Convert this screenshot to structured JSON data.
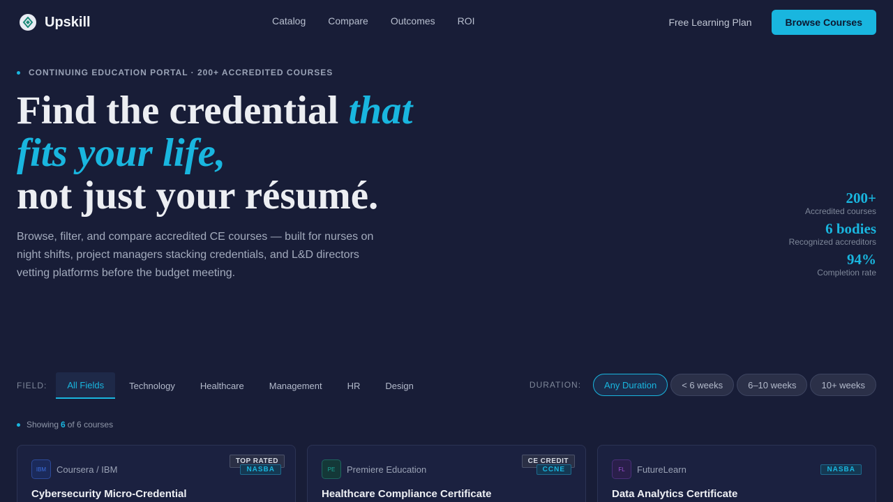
{
  "brand": {
    "name": "Upskill"
  },
  "nav": {
    "links": [
      "Catalog",
      "Compare",
      "Outcomes",
      "ROI"
    ],
    "free_plan": "Free Learning Plan",
    "cta": "Browse Courses"
  },
  "hero": {
    "eyebrow": "CONTINUING EDUCATION PORTAL · 200+ ACCREDITED COURSES",
    "headline_part1": "Find the credential ",
    "headline_accent1": "that",
    "headline_accent2": "fits your life,",
    "headline_part2": "not just your résumé.",
    "lede": "Browse, filter, and compare accredited CE courses — built for nurses on night shifts, project managers stacking credentials, and L&D directors vetting platforms before the budget meeting."
  },
  "stats": [
    {
      "value": "200+",
      "label": "Accredited courses"
    },
    {
      "value": "6 bodies",
      "label": "Recognized accreditors"
    },
    {
      "value": "94%",
      "label": "Completion rate"
    }
  ],
  "filters": {
    "field_label": "FIELD:",
    "fields": [
      "All Fields",
      "Technology",
      "Healthcare",
      "Management",
      "HR",
      "Design"
    ],
    "active_field": "All Fields",
    "duration_label": "DURATION:",
    "durations": [
      "Any Duration",
      "< 6 weeks",
      "6–10 weeks",
      "10+ weeks"
    ],
    "active_duration": "Any Duration"
  },
  "results": {
    "prefix": "Showing",
    "count": "6",
    "suffix": "of 6 courses"
  },
  "courses": [
    {
      "provider": "Coursera / IBM",
      "logo": "IBM",
      "logo_color": "#3b6fe0",
      "title": "Cybersecurity Micro-Credential",
      "top_badge": "TOP RATED",
      "accreditor": "NASBA"
    },
    {
      "provider": "Premiere Education",
      "logo": "PE",
      "logo_color": "#1aa89a",
      "title": "Healthcare Compliance Certificate",
      "top_badge": "CE CREDIT",
      "accreditor": "CCNE"
    },
    {
      "provider": "FutureLearn",
      "logo": "FL",
      "logo_color": "#9b4fd6",
      "title": "Data Analytics Certificate",
      "top_badge": "",
      "accreditor": "NASBA"
    }
  ],
  "colors": {
    "accent": "#19b6df",
    "background": "#181d37"
  },
  "icons": {
    "logo": "upskill-logo-icon"
  }
}
